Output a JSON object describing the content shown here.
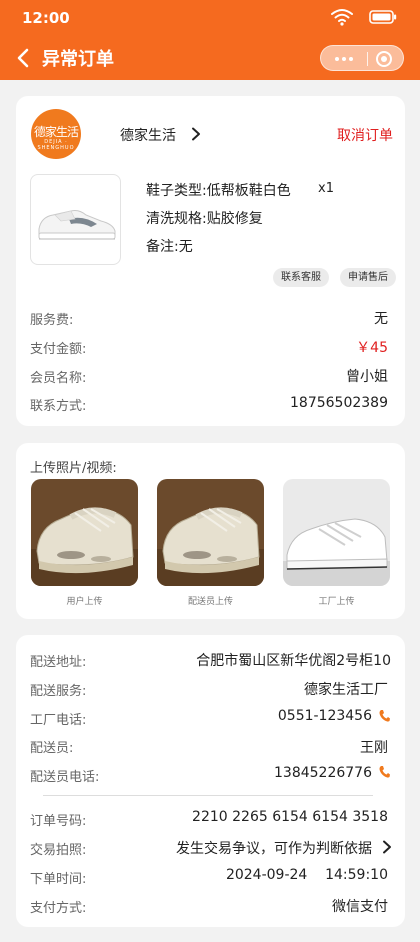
{
  "status_bar": {
    "time": "12:00"
  },
  "header": {
    "title": "异常订单"
  },
  "shop": {
    "logo_text": "德家生活",
    "logo_subtext": "DEJIA · SHENGHUO",
    "name": "德家生活",
    "cancel_label": "取消订单"
  },
  "item": {
    "shoe_type_label": "鞋子类型:",
    "shoe_type_value": "低帮板鞋白色",
    "quantity": "x1",
    "wash_label": "清洗规格:",
    "wash_value": "贴胶修复",
    "note_label": "备注:",
    "note_value": "无",
    "contact_label": "联系客服",
    "after_sale_label": "申请售后"
  },
  "summary": [
    {
      "label": "服务费:",
      "value": "无"
    },
    {
      "label": "支付金额:",
      "value": "￥45"
    },
    {
      "label": "会员名称:",
      "value": "曾小姐"
    },
    {
      "label": "联系方式:",
      "value": "18756502389"
    }
  ],
  "uploads": {
    "title": "上传照片/视频:",
    "photos": [
      {
        "caption": "用户上传"
      },
      {
        "caption": "配送员上传"
      },
      {
        "caption": "工厂上传"
      }
    ]
  },
  "delivery": [
    {
      "label": "配送地址:",
      "value": "合肥市蜀山区新华优阁2号柜10"
    },
    {
      "label": "配送服务:",
      "value": "德家生活工厂"
    },
    {
      "label": "工厂电话:",
      "value": "0551-123456"
    },
    {
      "label": "配送员:",
      "value": "王刚"
    },
    {
      "label": "配送员电话:",
      "value": "13845226776"
    }
  ],
  "order": [
    {
      "label": "订单号码:",
      "value": "2210 2265 6154 6154 3518"
    },
    {
      "label": "交易拍照:",
      "value": "发生交易争议，可作为判断依据"
    },
    {
      "label": "下单时间:",
      "value": "2024-09-24    14:59:10"
    },
    {
      "label": "支付方式:",
      "value": "微信支付"
    }
  ],
  "colors": {
    "brand": "#f56a1f",
    "price": "#e02020",
    "phone": "#f07a1e"
  }
}
